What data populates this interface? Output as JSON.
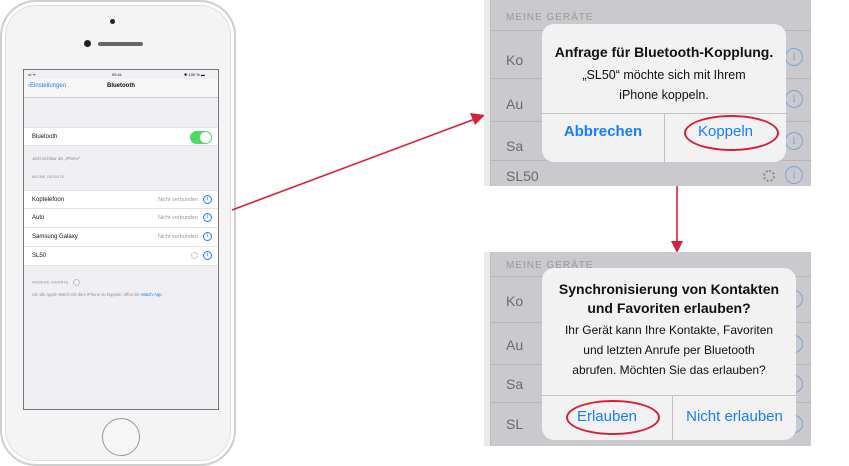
{
  "phone": {
    "status": {
      "signal": "•ıl ᯤ",
      "time": "09:41",
      "battery": "✱ 100 % ▬"
    },
    "nav": {
      "back_label": "Einstellungen",
      "title": "Bluetooth"
    },
    "bluetooth_row": {
      "label": "Bluetooth",
      "toggle_on": true
    },
    "visible_note": "Jetzt sichtbar als „iPhone“",
    "my_devices_header": "MEINE GERÄTE",
    "devices": [
      {
        "name": "Koptelefoon",
        "status": "Nicht verbunden"
      },
      {
        "name": "Auto",
        "status": "Nicht verbunden"
      },
      {
        "name": "Samsung Galaxy",
        "status": "Nicht verbunden"
      },
      {
        "name": "SL50",
        "status": ""
      }
    ],
    "other_devices_header": "ANDERE GERÄTE",
    "footer_text": "Um die Apple Watch mit dem iPhone zu koppeln, öffne die",
    "footer_link": "Watch-App."
  },
  "pairing_dialog": {
    "bg_section": "MEINE GERÄTE",
    "bg_rows": [
      "Ko",
      "Au",
      "Sa",
      "SL50"
    ],
    "title": "Anfrage für Bluetooth-Kopplung.",
    "message_line1": "„SL50“ möchte sich mit Ihrem",
    "message_line2": "iPhone koppeln.",
    "cancel_label": "Abbrechen",
    "confirm_label": "Koppeln"
  },
  "sync_dialog": {
    "bg_section": "MEINE GERÄTE",
    "bg_rows": [
      "Ko",
      "Au",
      "Sa",
      "SL"
    ],
    "title_line1": "Synchronisierung von Kontakten",
    "title_line2": "und Favoriten erlauben?",
    "message_line1": "Ihr Gerät kann Ihre Kontakte, Favoriten",
    "message_line2": "und letzten Anrufe per Bluetooth",
    "message_line3": "abrufen. Möchten Sie das erlauben?",
    "allow_label": "Erlauben",
    "deny_label": "Nicht erlauben"
  },
  "colors": {
    "accent": "#147efb",
    "toggle": "#4cd964",
    "highlight": "#d6203a"
  },
  "icons": {
    "info": "ⓘ",
    "spinner": "activity-indicator"
  }
}
